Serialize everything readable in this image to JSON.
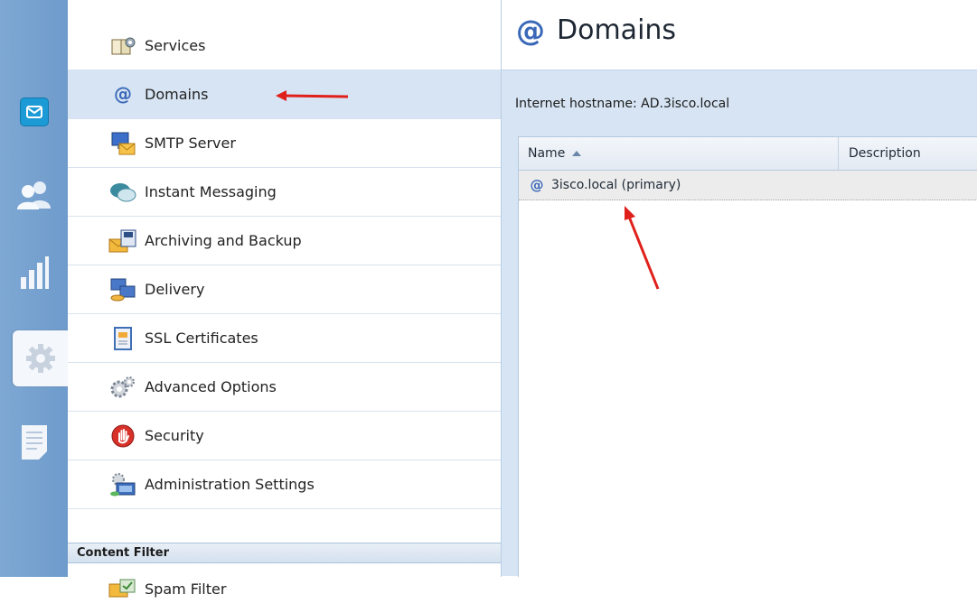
{
  "rail": {
    "items": [
      {
        "name": "mail-icon"
      },
      {
        "name": "users-icon"
      },
      {
        "name": "statistics-icon"
      },
      {
        "name": "gear-icon",
        "active": true
      },
      {
        "name": "document-icon"
      }
    ]
  },
  "menu": {
    "items": [
      {
        "label": "Services",
        "icon": "services-icon"
      },
      {
        "label": "Domains",
        "icon": "at-sign-icon",
        "selected": true
      },
      {
        "label": "SMTP Server",
        "icon": "smtp-server-icon"
      },
      {
        "label": "Instant Messaging",
        "icon": "chat-bubbles-icon"
      },
      {
        "label": "Archiving and Backup",
        "icon": "archive-icon"
      },
      {
        "label": "Delivery",
        "icon": "delivery-icon"
      },
      {
        "label": "SSL Certificates",
        "icon": "certificate-icon"
      },
      {
        "label": "Advanced Options",
        "icon": "gears-icon"
      },
      {
        "label": "Security",
        "icon": "stop-hand-icon"
      },
      {
        "label": "Administration Settings",
        "icon": "admin-settings-icon"
      }
    ],
    "section_header": "Content Filter",
    "section_items": [
      {
        "label": "Spam Filter",
        "icon": "spam-filter-icon"
      }
    ]
  },
  "content": {
    "title": "Domains",
    "hostname_label": "Internet hostname: AD.3isco.local",
    "grid": {
      "columns": [
        "Name",
        "Description"
      ],
      "sort_column": "Name",
      "sort_direction": "ascending",
      "rows": [
        {
          "name": "3isco.local (primary)",
          "description": ""
        }
      ]
    }
  },
  "annotations": {
    "arrow_color": "#e0201b"
  }
}
